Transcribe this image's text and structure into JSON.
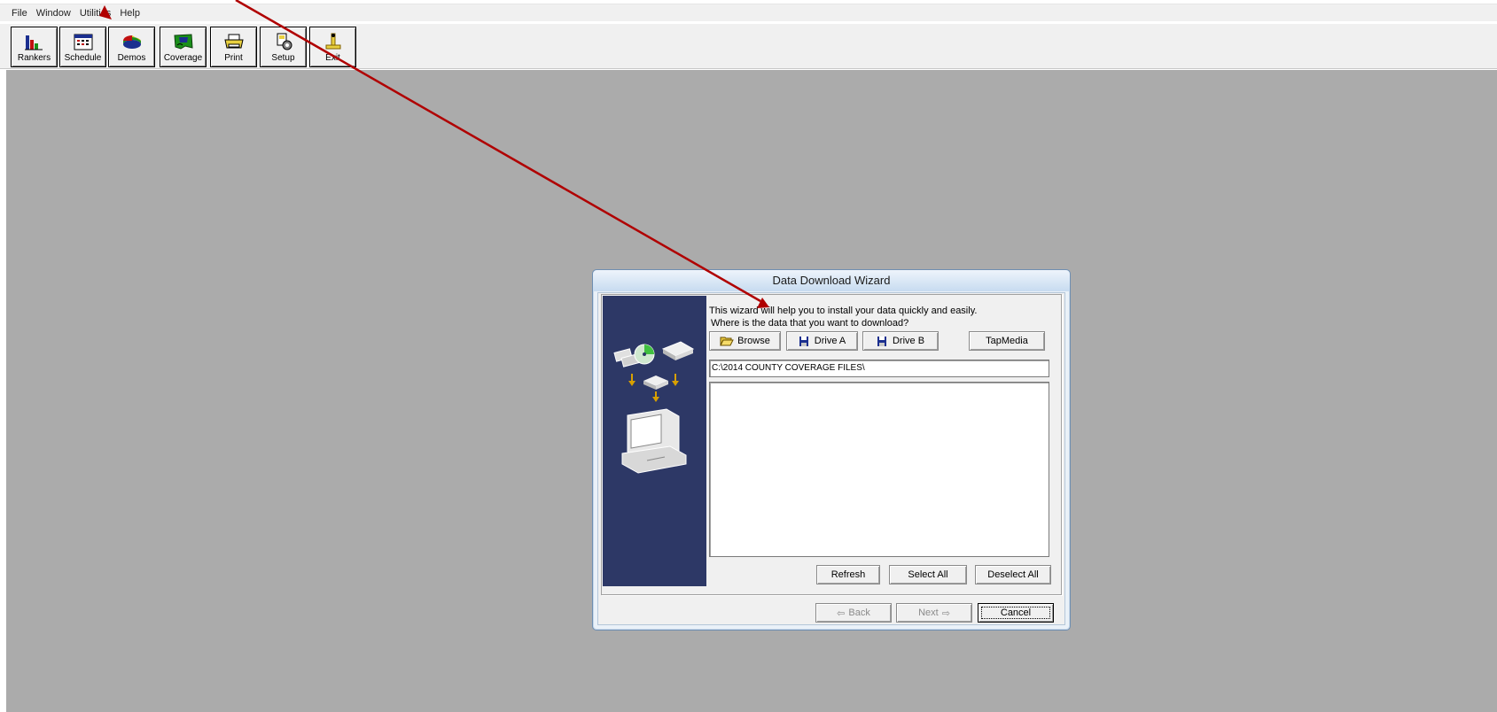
{
  "menubar": {
    "items": [
      "File",
      "Window",
      "Utilities",
      "Help"
    ]
  },
  "toolbar": {
    "buttons": [
      {
        "label": "Rankers",
        "icon": "rankers-icon"
      },
      {
        "label": "Schedule",
        "icon": "schedule-icon"
      },
      {
        "label": "Demos",
        "icon": "demos-icon"
      },
      {
        "label": "Coverage",
        "icon": "coverage-icon"
      },
      {
        "label": "Print",
        "icon": "print-icon"
      },
      {
        "label": "Setup",
        "icon": "setup-icon"
      },
      {
        "label": "Exit",
        "icon": "exit-icon"
      }
    ]
  },
  "dialog": {
    "title": "Data Download Wizard",
    "intro_line1": "This wizard will help you to install your data quickly and easily.",
    "intro_line2": "Where is the data that you want to download?",
    "browse_label": "Browse",
    "drive_a_label": "Drive A",
    "drive_b_label": "Drive B",
    "tapmedia_label": "TapMedia",
    "path_value": "C:\\2014 COUNTY COVERAGE FILES\\",
    "refresh_label": "Refresh",
    "select_all_label": "Select All",
    "deselect_all_label": "Deselect All",
    "back_label": "Back",
    "next_label": "Next",
    "cancel_label": "Cancel"
  },
  "colors": {
    "workspace": "#ababab",
    "side_panel": "#2d3866",
    "annotation_arrow": "#b00000"
  }
}
